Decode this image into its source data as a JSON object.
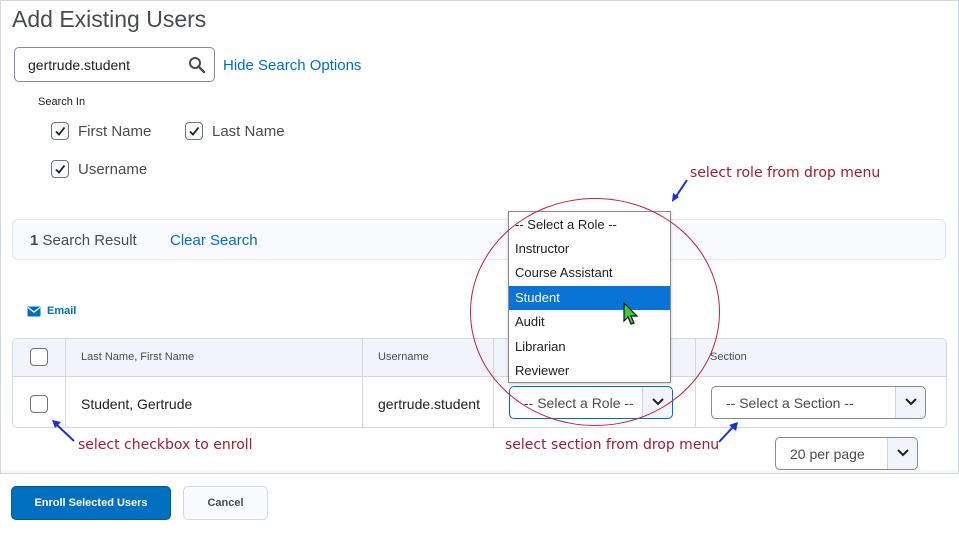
{
  "page": {
    "title": "Add Existing Users"
  },
  "search": {
    "value": "gertrude.student",
    "hide_options_label": "Hide Search Options"
  },
  "search_in": {
    "label": "Search In",
    "options": [
      {
        "label": "First Name",
        "checked": true
      },
      {
        "label": "Last Name",
        "checked": true
      },
      {
        "label": "Username",
        "checked": true
      }
    ]
  },
  "results": {
    "count": "1",
    "count_suffix": " Search Result",
    "clear_label": "Clear Search"
  },
  "actions": {
    "email_label": "Email"
  },
  "table": {
    "headers": {
      "name": "Last Name, First Name",
      "username": "Username",
      "section": "Section"
    },
    "rows": [
      {
        "name": "Student, Gertrude",
        "username": "gertrude.student",
        "role": "-- Select a Role --",
        "section": "-- Select a Section --"
      }
    ]
  },
  "role_dropdown": {
    "options": [
      "-- Select a Role --",
      "Instructor",
      "Course Assistant",
      "Student",
      "Audit",
      "Librarian",
      "Reviewer"
    ],
    "highlighted": "Student"
  },
  "pagination": {
    "per_page": "20 per page"
  },
  "footer": {
    "enroll_label": "Enroll Selected Users",
    "cancel_label": "Cancel"
  },
  "annotations": {
    "role": "select role from drop menu",
    "checkbox": "select checkbox to enroll",
    "section": "select section from drop menu"
  },
  "colors": {
    "link": "#006fbf",
    "primary": "#006fbf",
    "annotation": "#a11b31",
    "highlight": "#0a73d8"
  }
}
